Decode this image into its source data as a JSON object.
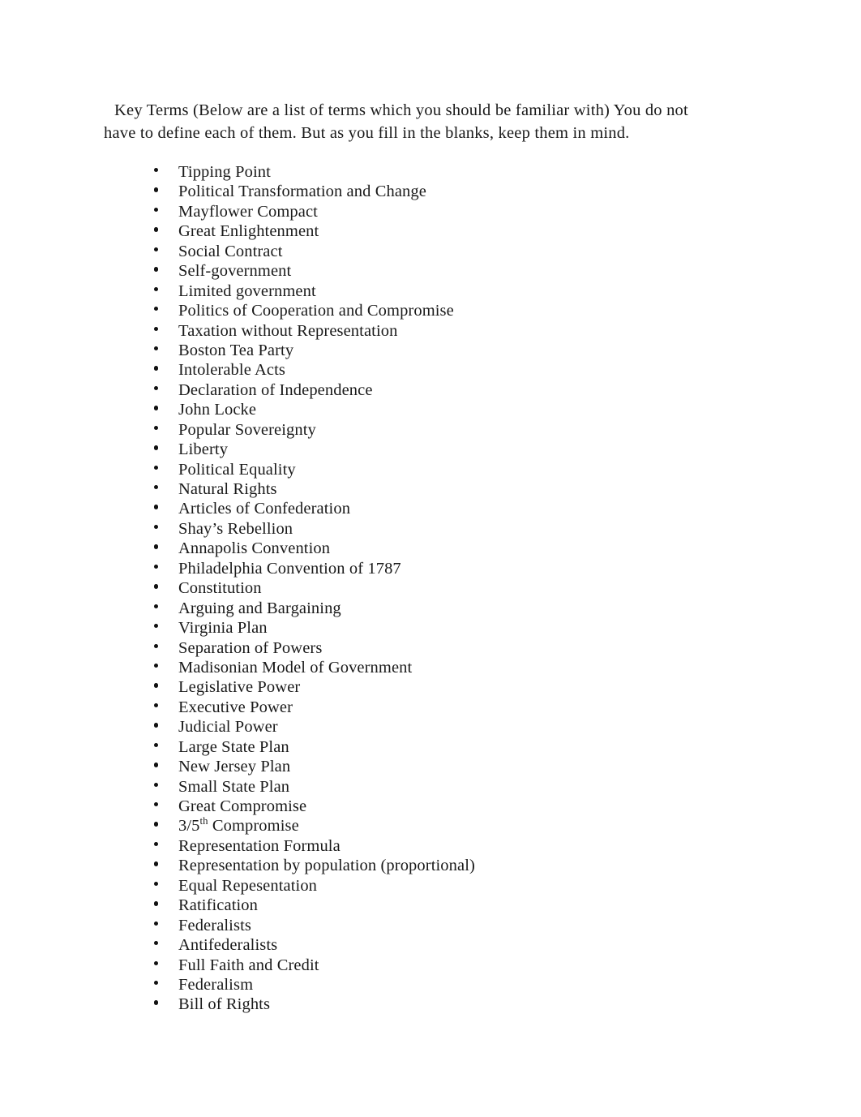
{
  "document": {
    "background_color": "#ffffff",
    "text_color": "#1a1a1a",
    "intro": "Key Terms (Below are a list of terms which you should be familiar with) You do not have to define each of them. But as you fill in the blanks, keep them in mind.",
    "bullet_glyph": "bullet-dot",
    "terms": [
      {
        "text": "Tipping Point"
      },
      {
        "text": "Political Transformation and Change"
      },
      {
        "text": "Mayflower Compact"
      },
      {
        "text": "Great Enlightenment"
      },
      {
        "text": "Social Contract"
      },
      {
        "text": "Self-government"
      },
      {
        "text": "Limited government"
      },
      {
        "text": "Politics of Cooperation and Compromise"
      },
      {
        "text": "Taxation without Representation"
      },
      {
        "text": "Boston Tea Party"
      },
      {
        "text": "Intolerable Acts"
      },
      {
        "text": "Declaration of Independence"
      },
      {
        "text": "John Locke"
      },
      {
        "text": "Popular Sovereignty"
      },
      {
        "text": "Liberty"
      },
      {
        "text": "Political Equality"
      },
      {
        "text": "Natural Rights"
      },
      {
        "text": "Articles of Confederation"
      },
      {
        "text": "Shay’s Rebellion"
      },
      {
        "text": "Annapolis Convention"
      },
      {
        "text": "Philadelphia Convention of 1787"
      },
      {
        "text": "Constitution"
      },
      {
        "text": "Arguing and Bargaining"
      },
      {
        "text": "Virginia Plan"
      },
      {
        "text": "Separation of Powers"
      },
      {
        "text": "Madisonian Model of Government"
      },
      {
        "text": "Legislative Power"
      },
      {
        "text": "Executive Power"
      },
      {
        "text": "Judicial Power"
      },
      {
        "text": "Large State Plan"
      },
      {
        "text": "New Jersey Plan"
      },
      {
        "text": "Small State Plan"
      },
      {
        "text": "Great Compromise"
      },
      {
        "text": "3/5",
        "superscript": "th",
        "text_after": " Compromise"
      },
      {
        "text": "Representation Formula"
      },
      {
        "text": "Representation by population (proportional)"
      },
      {
        "text": "Equal Repesentation"
      },
      {
        "text": "Ratification"
      },
      {
        "text": "Federalists"
      },
      {
        "text": "Antifederalists"
      },
      {
        "text": "Full Faith and Credit"
      },
      {
        "text": "Federalism"
      },
      {
        "text": "Bill of Rights"
      }
    ]
  }
}
